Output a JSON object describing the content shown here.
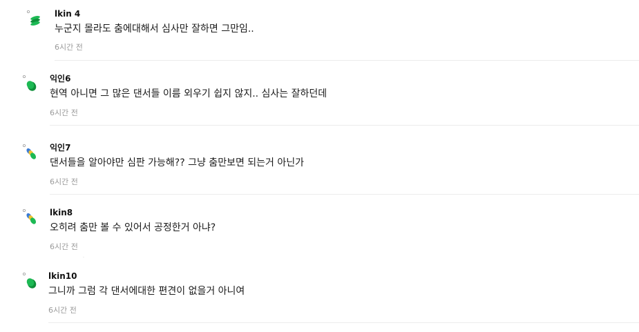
{
  "comments": [
    {
      "nickname": "lkin 4",
      "text": "누군지 몰라도 춤에대해서 심사만 잘하면 그만임..",
      "time": "6시간 전",
      "avatar_icon": "tilted-stack-leaf-icon"
    },
    {
      "nickname": "익인6",
      "text": "현역 아니면 그 많은 댄서들 이름 외우기 쉽지 않지.. 심사는 잘하던데",
      "time": "6시간 전",
      "avatar_icon": "green-leaf-icon"
    },
    {
      "nickname": "익인7",
      "text": "댄서들을 알아야만 심판 가능해?? 그냥 춤만보면 되는거 아닌가",
      "time": "6시간 전",
      "avatar_icon": "blue-yellow-leaf-icon"
    },
    {
      "nickname": "lkin8",
      "text": "오히려 춤만 볼 수 있어서 공정한거 아냐?",
      "time": "6시간 전",
      "avatar_icon": "blue-yellow-leaf-icon"
    },
    {
      "nickname": "lkin10",
      "text": "그니까 그럼 각 댄서에대한 편견이 없을거 아니여",
      "time": "6시간 전",
      "avatar_icon": "green-leaf-icon"
    }
  ],
  "colors": {
    "leaf_green": "#1db954",
    "leaf_dark_green": "#0f8f3a",
    "leaf_blue": "#3a7bd5",
    "leaf_yellow": "#f2c230",
    "time_gray": "#9a9a9a",
    "divider": "#ececec"
  }
}
